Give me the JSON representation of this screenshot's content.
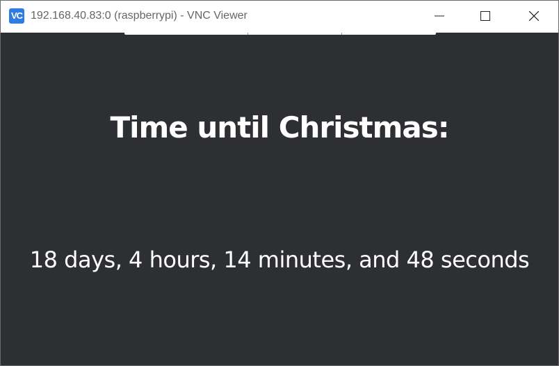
{
  "window": {
    "title": "192.168.40.83:0 (raspberrypi) - VNC Viewer",
    "app_icon": "VC",
    "icons": {
      "app": "vnc-viewer-icon",
      "minimize": "minimize-icon",
      "maximize": "maximize-icon",
      "close": "close-icon"
    }
  },
  "content": {
    "heading": "Time until Christmas:",
    "countdown": "18 days, 4 hours, 14 minutes, and 48 seconds"
  },
  "colors": {
    "background": "#2d2f33",
    "text": "#ffffff",
    "titlebar": "#ffffff",
    "accent": "#2f7de1"
  }
}
